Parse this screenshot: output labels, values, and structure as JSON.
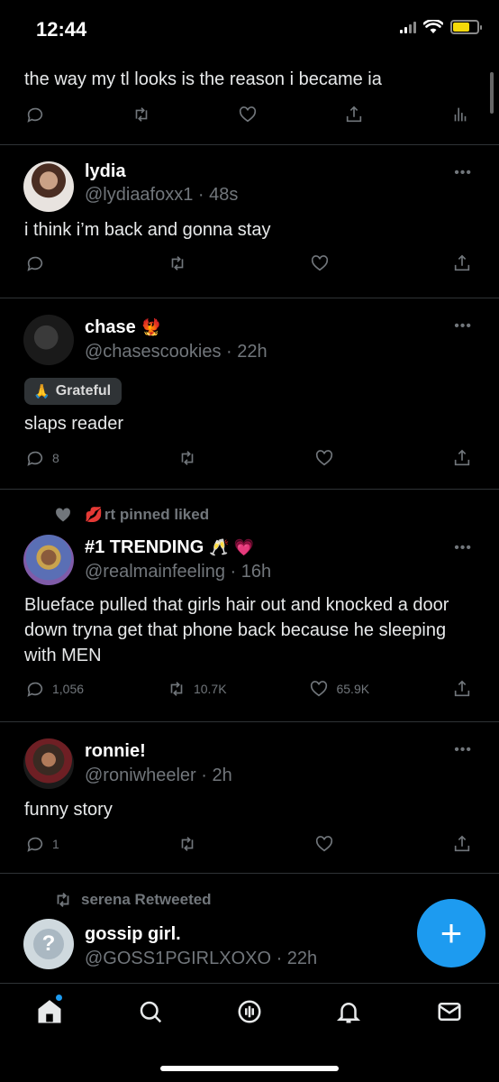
{
  "status_bar": {
    "time": "12:44"
  },
  "tweets": [
    {
      "text": "the way my tl looks is the reason i became ia",
      "actions": {
        "reply": "",
        "retweet": "",
        "like": ""
      }
    },
    {
      "name": "lydia",
      "handle": "@lydiaafoxx1 · 48s",
      "text": "i think i’m back and gonna stay",
      "actions": {
        "reply": "",
        "retweet": "",
        "like": ""
      }
    },
    {
      "name": "chase",
      "name_emoji": "🐦‍🔥",
      "handle": "@chasescookies · 22h",
      "mood_emoji": "🙏",
      "mood": "Grateful",
      "text": "slaps reader",
      "actions": {
        "reply": "8",
        "retweet": "",
        "like": ""
      }
    },
    {
      "context": "rt pinned liked",
      "context_emoji": "💋",
      "name": "#1 TRENDING",
      "name_emoji": "🥂 💗",
      "handle": "@realmainfeeling · 16h",
      "text": "Blueface pulled that girls hair out and knocked a door down tryna get that phone back because he sleeping with MEN",
      "actions": {
        "reply": "1,056",
        "retweet": "10.7K",
        "like": "65.9K"
      }
    },
    {
      "name": "ronnie!",
      "handle": "@roniwheeler · 2h",
      "text": "funny story",
      "actions": {
        "reply": "1",
        "retweet": "",
        "like": ""
      }
    },
    {
      "context": "serena Retweeted",
      "name": "gossip girl.",
      "handle": "@GOSS1PGIRLXOXO · 22h"
    }
  ],
  "more_glyph": "•••",
  "fab_glyph": "+",
  "colors": {
    "accent": "#1d9bf0",
    "muted": "#71767b",
    "divider": "#2f3336"
  },
  "tabs": [
    "home-icon",
    "search-icon",
    "spaces-icon",
    "notifications-icon",
    "messages-icon"
  ]
}
